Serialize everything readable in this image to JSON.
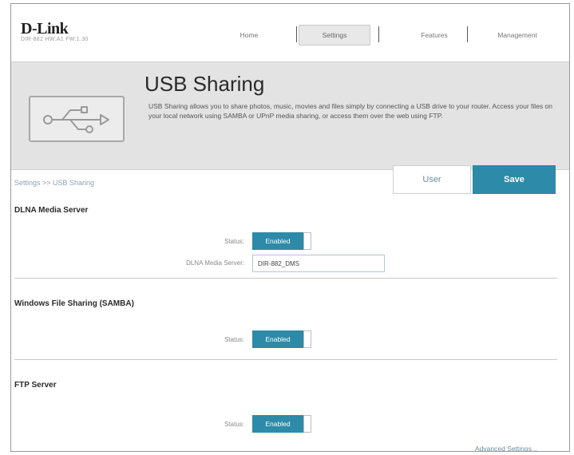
{
  "header": {
    "logo": "D-Link",
    "model": "DIR-882 HW:A1 FW:1.30",
    "nav": {
      "home": "Home",
      "settings": "Settings",
      "features": "Features",
      "management": "Management"
    }
  },
  "banner": {
    "title": "USB Sharing",
    "description": "USB Sharing allows you to share photos, music, movies and files simply by connecting a USB drive to your router. Access your files on your local network using SAMBA or UPnP media sharing, or access them over the web using FTP.",
    "icon": "usb-icon"
  },
  "breadcrumb": "Settings >> USB Sharing",
  "actions": {
    "user": "User",
    "save": "Save"
  },
  "sections": {
    "dlna": {
      "title": "DLNA Media Server",
      "status_label": "Status:",
      "status_value": "Enabled",
      "server_label": "DLNA Media Server:",
      "server_value": "DIR-882_DMS"
    },
    "samba": {
      "title": "Windows File Sharing (SAMBA)",
      "status_label": "Status:",
      "status_value": "Enabled"
    },
    "ftp": {
      "title": "FTP Server",
      "status_label": "Status:",
      "status_value": "Enabled"
    }
  },
  "advanced_link": "Advanced Settings...",
  "colors": {
    "accent": "#2d8aa8",
    "banner_bg": "#e3e3e3",
    "link": "#6a8ea4"
  }
}
